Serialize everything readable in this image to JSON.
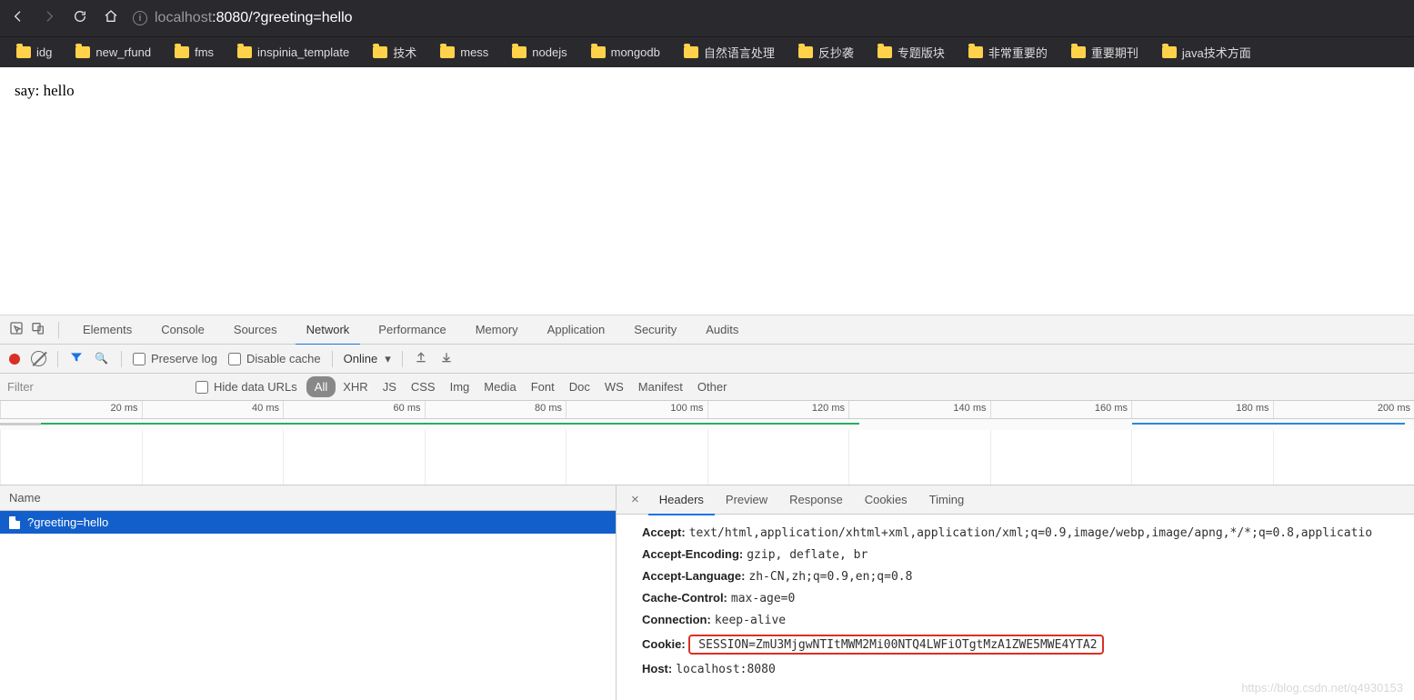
{
  "browser": {
    "url_dim1": "localhost",
    "url_port": ":8080",
    "url_path": "/?greeting=hello",
    "bookmarks": [
      "idg",
      "new_rfund",
      "fms",
      "inspinia_template",
      "技术",
      "mess",
      "nodejs",
      "mongodb",
      "自然语言处理",
      "反抄袭",
      "专题版块",
      "非常重要的",
      "重要期刊",
      "java技术方面"
    ]
  },
  "page": {
    "body_text": "say: hello"
  },
  "devtools": {
    "tabs": [
      "Elements",
      "Console",
      "Sources",
      "Network",
      "Performance",
      "Memory",
      "Application",
      "Security",
      "Audits"
    ],
    "active_tab": "Network",
    "toolbar": {
      "preserve_log": "Preserve log",
      "disable_cache": "Disable cache",
      "throttling": "Online"
    },
    "filter": {
      "placeholder": "Filter",
      "hide_data_urls": "Hide data URLs",
      "types": [
        "All",
        "XHR",
        "JS",
        "CSS",
        "Img",
        "Media",
        "Font",
        "Doc",
        "WS",
        "Manifest",
        "Other"
      ],
      "active_type": "All"
    },
    "timeline_ticks": [
      "20 ms",
      "40 ms",
      "60 ms",
      "80 ms",
      "100 ms",
      "120 ms",
      "140 ms",
      "160 ms",
      "180 ms",
      "200 ms"
    ],
    "requests": {
      "header": "Name",
      "rows": [
        "?greeting=hello"
      ]
    },
    "details": {
      "tabs": [
        "Headers",
        "Preview",
        "Response",
        "Cookies",
        "Timing"
      ],
      "active": "Headers",
      "headers": {
        "Accept": "text/html,application/xhtml+xml,application/xml;q=0.9,image/webp,image/apng,*/*;q=0.8,applicatio",
        "Accept-Encoding": "gzip, deflate, br",
        "Accept-Language": "zh-CN,zh;q=0.9,en;q=0.8",
        "Cache-Control": "max-age=0",
        "Connection": "keep-alive",
        "Cookie": "SESSION=ZmU3MjgwNTItMWM2Mi00NTQ4LWFiOTgtMzA1ZWE5MWE4YTA2",
        "Host": "localhost:8080"
      }
    }
  },
  "watermark": "https://blog.csdn.net/q4930153"
}
